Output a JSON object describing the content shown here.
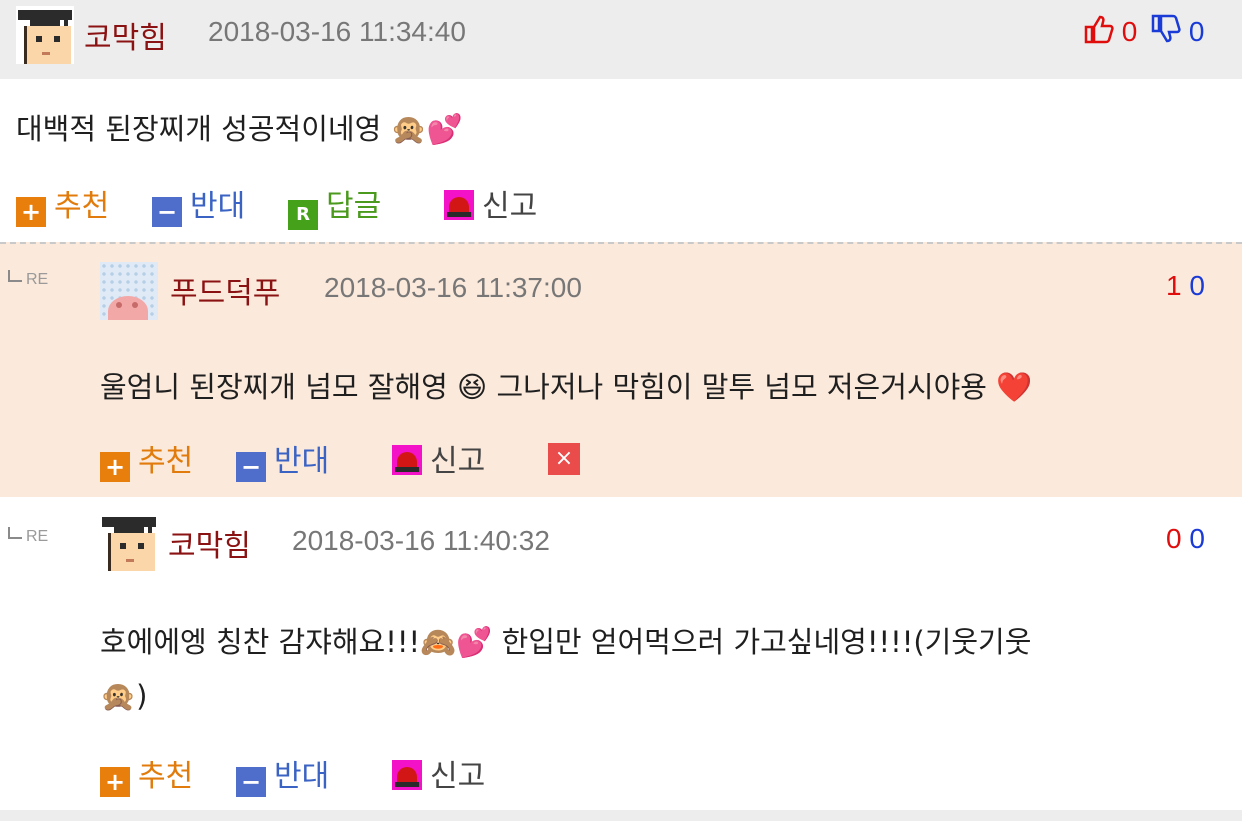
{
  "parent": {
    "nickname": "코막힘",
    "date": "2018-03-16 11:34:40",
    "likes": "0",
    "dislikes": "0",
    "body": "대백적 된장찌개 성공적이네영",
    "emoji1": "🙊",
    "emoji2": "💕",
    "actions": {
      "recommend": "추천",
      "oppose": "반대",
      "reply": "답글",
      "report": "신고"
    },
    "reply_icon_letter": "R"
  },
  "replies": [
    {
      "re_label": "RE",
      "nickname": "푸드덕푸",
      "date": "2018-03-16 11:37:00",
      "likes": "1",
      "dislikes": "0",
      "body_part1": "울엄니 된장찌개 넘모 잘해영",
      "emoji1": "😆",
      "body_part2": "그나저나 막힘이 말투 넘모 저은거시야용",
      "emoji2": "❤️",
      "actions": {
        "recommend": "추천",
        "oppose": "반대",
        "report": "신고"
      },
      "delete_icon": "×"
    },
    {
      "re_label": "RE",
      "nickname": "코막힘",
      "date": "2018-03-16 11:40:32",
      "likes": "0",
      "dislikes": "0",
      "line1_part1": "호에에엥 칭찬 감쟈해요!!!",
      "emoji1": "🙈",
      "emoji2": "💕",
      "line1_part2": "한입만 얻어먹으러 가고싶네영!!!!(기웃기웃",
      "emoji3": "🙊",
      "line2_tail": ")",
      "actions": {
        "recommend": "추천",
        "oppose": "반대",
        "report": "신고"
      }
    }
  ],
  "icons": {
    "like": "thumbs-up-icon",
    "dislike": "thumbs-down-icon",
    "plus": "+",
    "minus": "−"
  },
  "colors": {
    "header_bg": "#ededed",
    "reply_bg": "#fbe9db",
    "nickname": "#8b1212",
    "recommend": "#e87e0b",
    "oppose": "#4f6ecb",
    "reply": "#46a11a",
    "report": "#f312c7",
    "like_count": "#e00d0d",
    "dislike_count": "#1a3bd6"
  }
}
